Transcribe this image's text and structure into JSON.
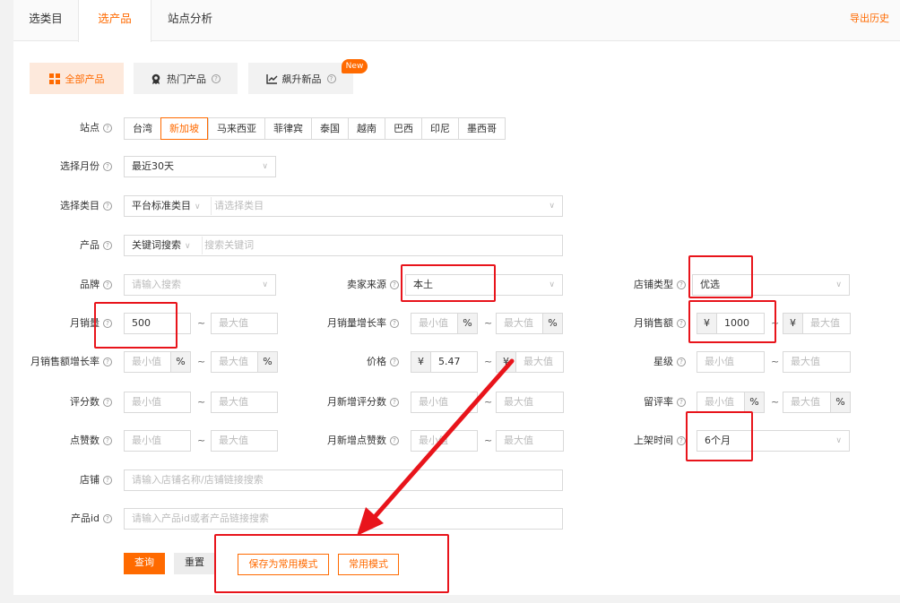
{
  "tabs": [
    "选类目",
    "选产品",
    "站点分析"
  ],
  "export_label": "导出历史",
  "product_tabs": [
    {
      "label": "全部产品",
      "icon": "grid-icon"
    },
    {
      "label": "热门产品",
      "icon": "medal-icon"
    },
    {
      "label": "飙升新品",
      "icon": "trend-icon"
    }
  ],
  "new_badge": "New",
  "help": "?",
  "tilde": "~",
  "currency": "¥",
  "percent": "%",
  "min_ph": "最小值",
  "max_ph": "最大值",
  "site": {
    "label": "站点",
    "options": [
      "台湾",
      "新加坡",
      "马来西亚",
      "菲律宾",
      "泰国",
      "越南",
      "巴西",
      "印尼",
      "墨西哥"
    ],
    "selected": "新加坡"
  },
  "month": {
    "label": "选择月份",
    "value": "最近30天"
  },
  "category": {
    "label": "选择类目",
    "type": "平台标准类目",
    "placeholder": "请选择类目"
  },
  "product": {
    "label": "产品",
    "type": "关键词搜索",
    "placeholder": "搜索关键词"
  },
  "brand": {
    "label": "品牌",
    "placeholder": "请输入搜索"
  },
  "seller_source": {
    "label": "卖家来源",
    "value": "本土"
  },
  "shop_type": {
    "label": "店铺类型",
    "value": "优选"
  },
  "monthly_sales": {
    "label": "月销量",
    "min": "500"
  },
  "sales_growth": {
    "label": "月销量增长率"
  },
  "monthly_revenue": {
    "label": "月销售额",
    "min": "1000"
  },
  "revenue_growth": {
    "label": "月销售额增长率"
  },
  "price": {
    "label": "价格",
    "min": "5.47"
  },
  "rating": {
    "label": "星级"
  },
  "reviews": {
    "label": "评分数"
  },
  "new_reviews": {
    "label": "月新增评分数"
  },
  "review_rate": {
    "label": "留评率"
  },
  "likes": {
    "label": "点赞数"
  },
  "new_likes": {
    "label": "月新增点赞数"
  },
  "listing_time": {
    "label": "上架时间",
    "value": "6个月"
  },
  "shop": {
    "label": "店铺",
    "placeholder": "请输入店铺名称/店铺链接搜索"
  },
  "product_id": {
    "label": "产品id",
    "placeholder": "请输入产品id或者产品链接搜索"
  },
  "buttons": {
    "query": "查询",
    "reset": "重置",
    "save_mode": "保存为常用模式",
    "common_mode": "常用模式"
  },
  "colors": {
    "accent": "#ff6a00",
    "highlight": "#e8141b"
  }
}
